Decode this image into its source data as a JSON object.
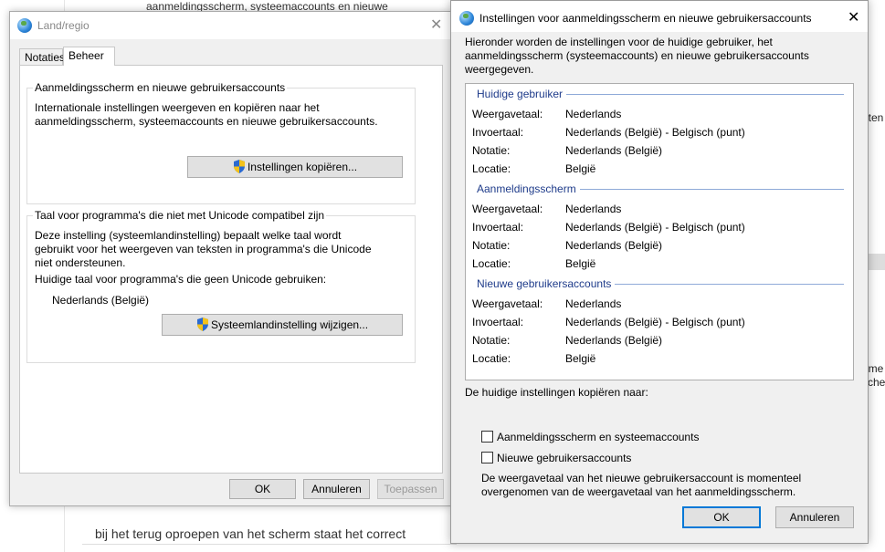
{
  "background": {
    "top_text": "aanmeldingsscherm, systeemaccounts en nieuwe gebruikersacc",
    "comment": "bij het terug oproepen van het scherm staat het correct",
    "right_texts": [
      "aten",
      "ome",
      "sche"
    ]
  },
  "left_dialog": {
    "title": "Land/regio",
    "tabs": [
      "Notaties",
      "Beheer"
    ],
    "group1": {
      "title": "Aanmeldingsscherm en nieuwe gebruikersaccounts",
      "text": "Internationale instellingen weergeven en kopiëren naar het aanmeldingsscherm, systeemaccounts en nieuwe gebruikersaccounts.",
      "button": "Instellingen kopiëren..."
    },
    "group2": {
      "title": "Taal voor programma's die niet met Unicode compatibel zijn",
      "text": "Deze instelling (systeemlandinstelling) bepaalt welke taal wordt gebruikt voor het weergeven van teksten in programma's die Unicode niet ondersteunen.",
      "current_label": "Huidige taal voor programma's die geen Unicode gebruiken:",
      "current_value": "Nederlands (België)",
      "button": "Systeemlandinstelling wijzigen..."
    },
    "buttons": {
      "ok": "OK",
      "cancel": "Annuleren",
      "apply": "Toepassen"
    }
  },
  "right_dialog": {
    "title": "Instellingen voor aanmeldingsscherm en nieuwe gebruikersaccounts",
    "intro": "Hieronder worden de instellingen voor de huidige gebruiker, het aanmeldingsscherm (systeemaccounts) en nieuwe gebruikersaccounts weergegeven.",
    "sections": [
      {
        "title": "Huidige gebruiker",
        "rows": [
          {
            "label": "Weergavetaal:",
            "value": "Nederlands"
          },
          {
            "label": "Invoertaal:",
            "value": "Nederlands (België) - Belgisch (punt)"
          },
          {
            "label": "Notatie:",
            "value": "Nederlands (België)"
          },
          {
            "label": "Locatie:",
            "value": "België"
          }
        ]
      },
      {
        "title": "Aanmeldingsscherm",
        "rows": [
          {
            "label": "Weergavetaal:",
            "value": "Nederlands"
          },
          {
            "label": "Invoertaal:",
            "value": "Nederlands (België) - Belgisch (punt)"
          },
          {
            "label": "Notatie:",
            "value": "Nederlands (België)"
          },
          {
            "label": "Locatie:",
            "value": "België"
          }
        ]
      },
      {
        "title": "Nieuwe gebruikersaccounts",
        "rows": [
          {
            "label": "Weergavetaal:",
            "value": "Nederlands"
          },
          {
            "label": "Invoertaal:",
            "value": "Nederlands (België) - Belgisch (punt)"
          },
          {
            "label": "Notatie:",
            "value": "Nederlands (België)"
          },
          {
            "label": "Locatie:",
            "value": "België"
          }
        ]
      }
    ],
    "copy_label": "De huidige instellingen kopiëren naar:",
    "checkboxes": [
      {
        "label": "Aanmeldingsscherm en systeemaccounts",
        "checked": false
      },
      {
        "label": "Nieuwe gebruikersaccounts",
        "checked": false
      }
    ],
    "note": "De weergavetaal van het nieuwe gebruikersaccount is momenteel overgenomen van de weergavetaal van het aanmeldingsscherm.",
    "buttons": {
      "ok": "OK",
      "cancel": "Annuleren"
    }
  },
  "icons": {
    "globe": "globe-icon",
    "shield": "uac-shield-icon",
    "close": "close-icon"
  },
  "colors": {
    "section_title": "#1e3b8a",
    "default_button_border": "#0078d7"
  }
}
